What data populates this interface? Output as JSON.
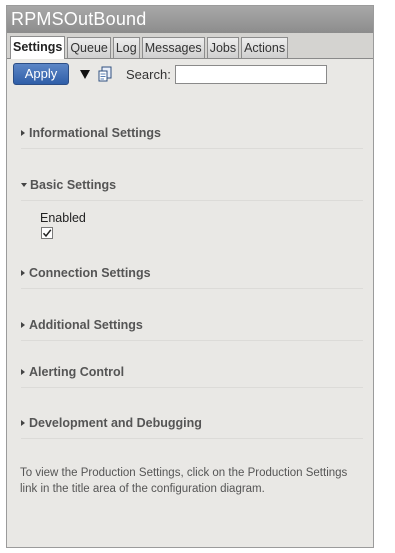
{
  "window": {
    "title": "RPMSOutBound"
  },
  "tabs": [
    {
      "label": "Settings",
      "active": true
    },
    {
      "label": "Queue",
      "active": false
    },
    {
      "label": "Log",
      "active": false
    },
    {
      "label": "Messages",
      "active": false
    },
    {
      "label": "Jobs",
      "active": false
    },
    {
      "label": "Actions",
      "active": false
    }
  ],
  "toolbar": {
    "apply_label": "Apply",
    "search_label": "Search:",
    "search_value": "",
    "icons": [
      "dropdown-triangle-icon",
      "document-icon"
    ]
  },
  "sections": [
    {
      "label": "Informational Settings",
      "expanded": false
    },
    {
      "label": "Basic Settings",
      "expanded": true
    },
    {
      "label": "Connection Settings",
      "expanded": false
    },
    {
      "label": "Additional Settings",
      "expanded": false
    },
    {
      "label": "Alerting Control",
      "expanded": false
    },
    {
      "label": "Development and Debugging",
      "expanded": false
    }
  ],
  "basic_settings": {
    "enabled_label": "Enabled",
    "enabled_checked": true
  },
  "footer": {
    "text": "To view the Production Settings, click on the Production Settings link in the title area of the configuration diagram."
  },
  "colors": {
    "title_bar": "#9a9a9a",
    "panel_bg": "#e9e8e5",
    "apply_button": "#3f6db3"
  }
}
